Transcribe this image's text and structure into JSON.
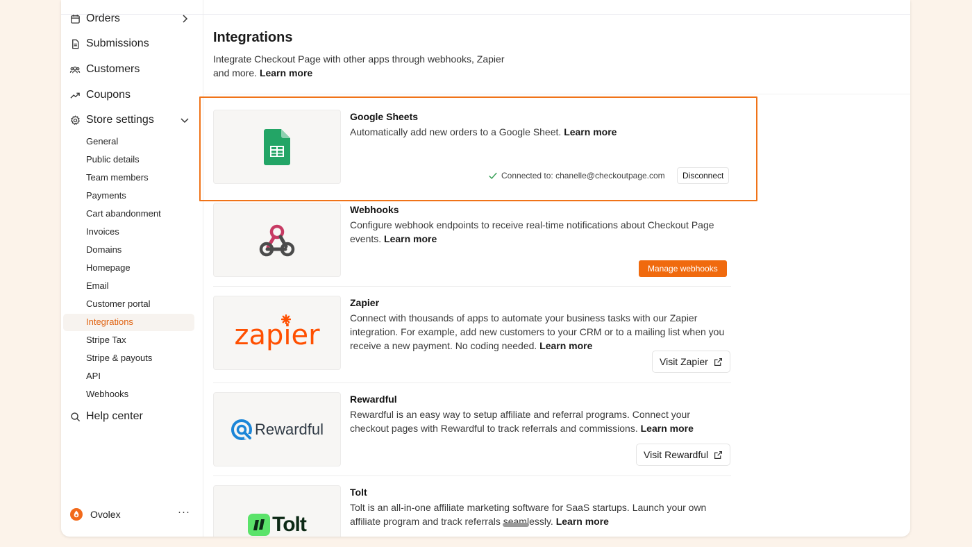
{
  "sidebar": {
    "main_items": [
      {
        "label": "Orders",
        "icon": "calendar-icon"
      },
      {
        "label": "Submissions",
        "icon": "document-icon"
      },
      {
        "label": "Customers",
        "icon": "users-icon"
      },
      {
        "label": "Coupons",
        "icon": "trending-icon"
      },
      {
        "label": "Store settings",
        "icon": "gear-icon"
      }
    ],
    "settings_items": [
      "General",
      "Public details",
      "Team members",
      "Payments",
      "Cart abandonment",
      "Invoices",
      "Domains",
      "Homepage",
      "Email",
      "Customer portal",
      "Integrations",
      "Stripe Tax",
      "Stripe & payouts",
      "API",
      "Webhooks"
    ],
    "active_item": "Integrations",
    "help_label": "Help center",
    "user_name": "Ovolex",
    "more_label": "···"
  },
  "header": {
    "title": "Integrations",
    "description": "Integrate Checkout Page with other apps through webhooks, Zapier and more.",
    "learn_more": "Learn more"
  },
  "integrations": [
    {
      "name": "Google Sheets",
      "description": "Automatically add new orders to a Google Sheet.",
      "learn_more": "Learn more",
      "status_prefix": "Connected to:",
      "status_email": "chanelle@checkoutpage.com",
      "action": "Disconnect"
    },
    {
      "name": "Webhooks",
      "description": "Configure webhook endpoints to receive real-time notifications about Checkout Page events.",
      "learn_more": "Learn more",
      "action": "Manage webhooks"
    },
    {
      "name": "Zapier",
      "description": "Connect with thousands of apps to automate your business tasks with our Zapier integration. For example, add new customers to your CRM or to a mailing list when you receive a new payment. No coding needed.",
      "learn_more": "Learn more",
      "action": "Visit Zapier",
      "logo_text": "zapier"
    },
    {
      "name": "Rewardful",
      "description": "Rewardful is an easy way to setup affiliate and referral programs. Connect your checkout pages with Rewardful to track referrals and commissions.",
      "learn_more": "Learn more",
      "action": "Visit Rewardful",
      "logo_text": "Rewardful"
    },
    {
      "name": "Tolt",
      "description": "Tolt is an all-in-one affiliate marketing software for SaaS startups. Launch your own affiliate program and track referrals seamlessly.",
      "learn_more": "Learn more",
      "logo_text": "Tolt"
    }
  ],
  "colors": {
    "accent": "#f06a0e",
    "highlight_border": "#f07318",
    "sheets_green": "#23a566",
    "connected_check": "#2e9b4f",
    "rewardful_blue": "#1c86d8",
    "tolt_green": "#5be36a",
    "background": "#fcf3ea"
  }
}
